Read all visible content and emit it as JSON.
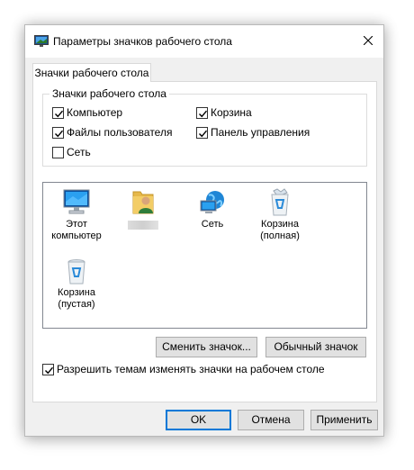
{
  "window": {
    "title": "Параметры значков рабочего стола",
    "close_glyph": "✕"
  },
  "tabs": [
    {
      "label": "Значки рабочего стола",
      "selected": true
    }
  ],
  "group": {
    "legend": "Значки рабочего стола",
    "checkboxes": [
      {
        "label": "Компьютер",
        "checked": true
      },
      {
        "label": "Корзина",
        "checked": true
      },
      {
        "label": "Файлы пользователя",
        "checked": true
      },
      {
        "label": "Панель управления",
        "checked": true
      },
      {
        "label": "Сеть",
        "checked": false
      }
    ]
  },
  "icons": [
    {
      "caption": "Этот\nкомпьютер",
      "icon": "computer-icon"
    },
    {
      "caption": "",
      "icon": "user-folder-icon",
      "caption_obscured": true
    },
    {
      "caption": "Сеть",
      "icon": "network-icon"
    },
    {
      "caption": "Корзина\n(полная)",
      "icon": "recycle-bin-full-icon"
    },
    {
      "caption": "Корзина\n(пустая)",
      "icon": "recycle-bin-empty-icon"
    }
  ],
  "icon_buttons": {
    "change": "Сменить значок...",
    "default": "Обычный значок"
  },
  "themes_checkbox": {
    "label": "Разрешить темам изменять значки на рабочем столе",
    "checked": true
  },
  "footer": {
    "ok": "OK",
    "cancel": "Отмена",
    "apply": "Применить"
  },
  "colors": {
    "accent": "#0078d7",
    "dialog_bg": "#f0f0f0",
    "button_bg": "#e1e1e1"
  }
}
